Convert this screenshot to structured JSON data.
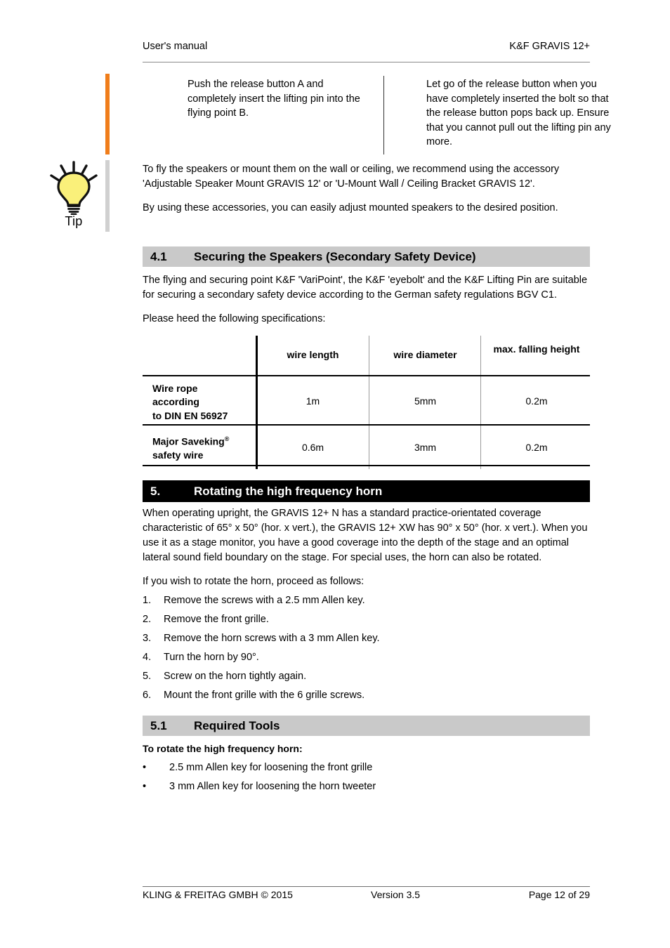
{
  "header": {
    "left": "User's manual",
    "right": "K&F GRAVIS 12+"
  },
  "instruction_columns": {
    "left": "Push the release button A and completely insert the lifting pin into the flying point B.",
    "right": "Let go of the release button when you have completely inserted the bolt so that the release button pops back up. Ensure that you cannot pull out the lifting pin any more."
  },
  "tip": {
    "icon": "lightbulb-icon",
    "label": "Tip",
    "bulb_color": "#faf07a",
    "rail_orange": "#f07d1a",
    "rail_gray": "#d0d0d0",
    "paragraphs": [
      "To fly the speakers or mount them on the wall or ceiling, we recommend using the accessory 'Adjustable Speaker Mount GRAVIS 12' or 'U-Mount Wall / Ceiling Bracket GRAVIS 12'.",
      "By using these accessories, you can easily adjust mounted speakers to the desired position."
    ]
  },
  "section_4_1": {
    "number": "4.1",
    "title": "Securing the Speakers (Secondary Safety Device)",
    "bg_color": "#c9c9c9",
    "paragraphs": [
      "The flying and securing point K&F 'VariPoint', the K&F 'eyebolt' and the K&F Lifting Pin are suitable for securing a secondary safety device according to the German safety regulations BGV C1.",
      "Please heed the following specifications:"
    ]
  },
  "spec_table": {
    "columns": [
      "",
      "wire length",
      "wire diameter",
      "max. falling height"
    ],
    "rows": [
      {
        "label_lines": [
          "Wire rope",
          "according",
          "to DIN EN 56927"
        ],
        "values": [
          "1m",
          "5mm",
          "0.2m"
        ]
      },
      {
        "label_lines": [
          "Major Saveking",
          "safety wire"
        ],
        "label_sup": "®",
        "values": [
          "0.6m",
          "3mm",
          "0.2m"
        ]
      }
    ]
  },
  "section_5": {
    "number": "5.",
    "title": "Rotating the high frequency horn",
    "bg_color": "#000000",
    "paragraphs": [
      "When operating upright, the GRAVIS 12+ N has a standard practice-orientated coverage characteristic of 65° x 50° (hor. x vert.), the GRAVIS 12+ XW has 90° x 50° (hor. x vert.). When you use it as a stage monitor, you have a good coverage into the depth of the stage and an optimal lateral sound field boundary on the stage. For special uses, the horn can also be rotated.",
      "If you wish to rotate the horn, proceed as follows:"
    ],
    "steps": [
      {
        "marker": "1.",
        "text": "Remove the screws with a 2.5 mm Allen key."
      },
      {
        "marker": "2.",
        "text": "Remove the front grille."
      },
      {
        "marker": "3.",
        "text": "Remove the horn screws with a 3 mm Allen key."
      },
      {
        "marker": "4.",
        "text": "Turn the horn by 90°."
      },
      {
        "marker": "5.",
        "text": "Screw on the horn tightly again."
      },
      {
        "marker": "6.",
        "text": "Mount the front grille with the 6 grille screws."
      }
    ]
  },
  "section_5_1": {
    "number": "5.1",
    "title": "Required Tools",
    "bg_color": "#c9c9c9",
    "lead": "To rotate the high frequency horn:",
    "bullets": [
      {
        "marker": "•",
        "text": "2.5 mm Allen key for loosening the front grille"
      },
      {
        "marker": "•",
        "text": "3 mm Allen key for loosening the horn tweeter"
      }
    ]
  },
  "footer": {
    "left": "KLING & FREITAG GMBH © 2015",
    "center": "Version 3.5",
    "right": "Page 12 of 29"
  }
}
